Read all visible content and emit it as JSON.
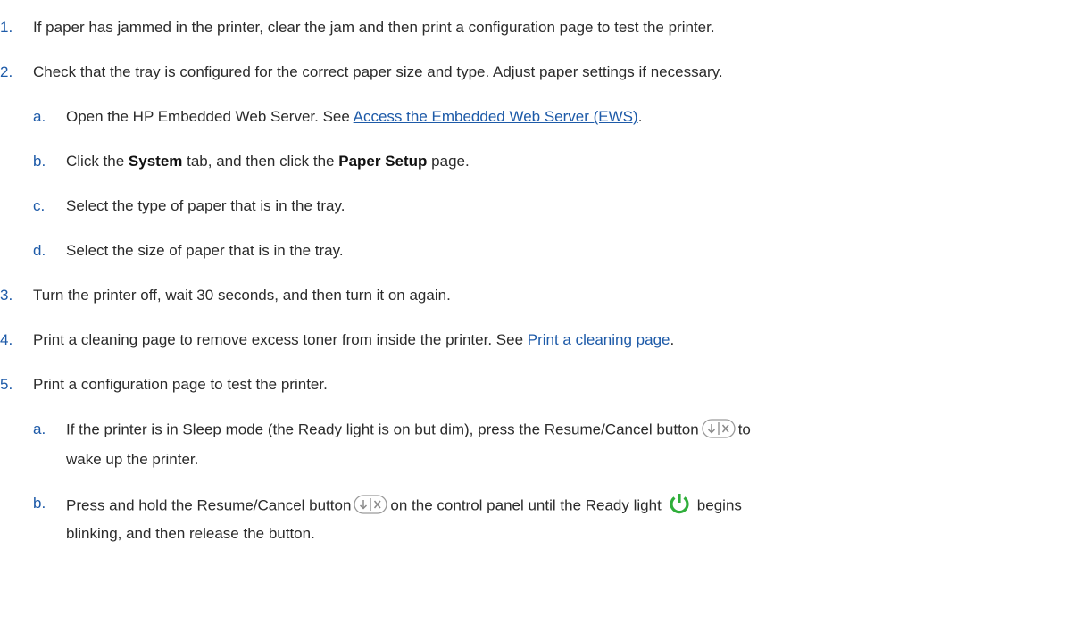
{
  "steps": [
    {
      "num": "1.",
      "text": "If paper has jammed in the printer, clear the jam and then print a configuration page to test the printer."
    },
    {
      "num": "2.",
      "text": "Check that the tray is configured for the correct paper size and type. Adjust paper settings if necessary.",
      "substeps": [
        {
          "num": "a.",
          "pre": "Open the HP Embedded Web Server. See ",
          "link": "Access the Embedded Web Server (EWS)",
          "post": "."
        },
        {
          "num": "b.",
          "t1": "Click the ",
          "b1": "System",
          "t2": " tab, and then click the ",
          "b2": "Paper Setup",
          "t3": " page."
        },
        {
          "num": "c.",
          "text": "Select the type of paper that is in the tray."
        },
        {
          "num": "d.",
          "text": "Select the size of paper that is in the tray."
        }
      ]
    },
    {
      "num": "3.",
      "text": "Turn the printer off, wait 30 seconds, and then turn it on again."
    },
    {
      "num": "4.",
      "pre": "Print a cleaning page to remove excess toner from inside the printer. See ",
      "link": "Print a cleaning page",
      "post": "."
    },
    {
      "num": "5.",
      "text": "Print a configuration page to test the printer.",
      "substeps": [
        {
          "num": "a.",
          "pre": "If the printer is in Sleep mode (the Ready light is on but dim), press the Resume/Cancel button",
          "post": "to",
          "line2": "wake up the printer."
        },
        {
          "num": "b.",
          "pre": "Press and hold the Resume/Cancel button",
          "mid": "on the control panel until the Ready light",
          "post": "begins",
          "line2": "blinking, and then release the button."
        }
      ]
    }
  ],
  "icons": {
    "resume_cancel": "resume-cancel-icon",
    "power": "power-icon",
    "power_color": "#2fae3a",
    "icon_gray": "#9a9a9a"
  }
}
